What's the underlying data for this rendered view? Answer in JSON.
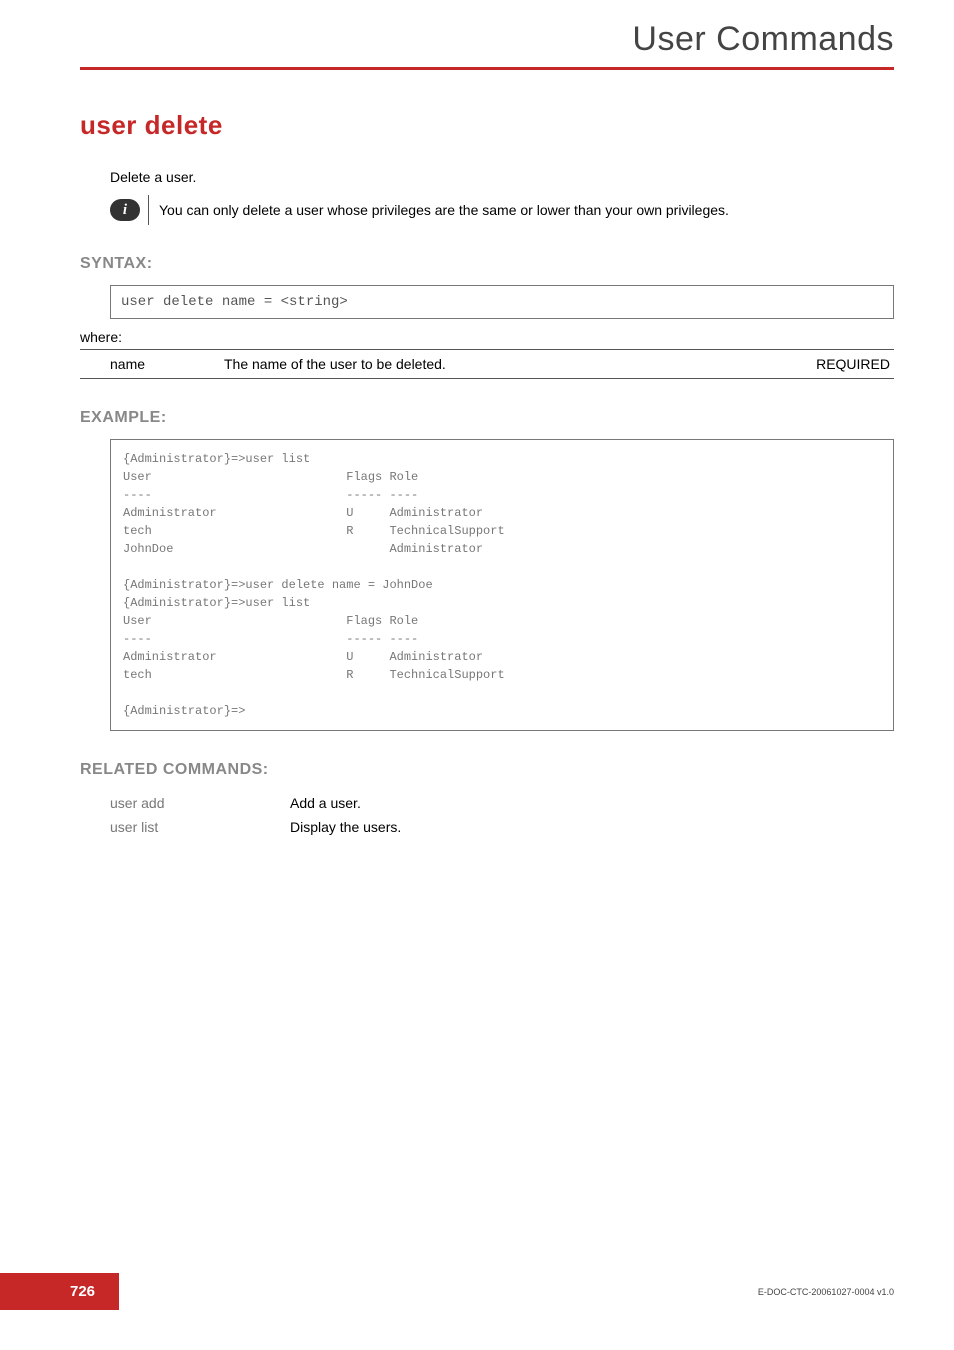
{
  "header": {
    "title": "User Commands"
  },
  "command": {
    "title": "user delete",
    "intro": "Delete a user.",
    "note": "You can only delete a user whose privileges are the same or lower than your own privileges."
  },
  "sections": {
    "syntax": "SYNTAX:",
    "example": "EXAMPLE:",
    "related": "RELATED COMMANDS:"
  },
  "syntax": {
    "code": "user delete  name = <string>",
    "where_label": "where:",
    "param": {
      "name": "name",
      "desc": "The name of the user to be deleted.",
      "req": "REQUIRED"
    }
  },
  "example_text": "{Administrator}=>user list\nUser                           Flags Role\n----                           ----- ----\nAdministrator                  U     Administrator\ntech                           R     TechnicalSupport\nJohnDoe                              Administrator\n\n{Administrator}=>user delete name = JohnDoe\n{Administrator}=>user list\nUser                           Flags Role\n----                           ----- ----\nAdministrator                  U     Administrator\ntech                           R     TechnicalSupport\n\n{Administrator}=>",
  "related": [
    {
      "name": "user add",
      "desc": "Add a user."
    },
    {
      "name": "user list",
      "desc": "Display the users."
    }
  ],
  "footer": {
    "page": "726",
    "docid": "E-DOC-CTC-20061027-0004 v1.0"
  }
}
